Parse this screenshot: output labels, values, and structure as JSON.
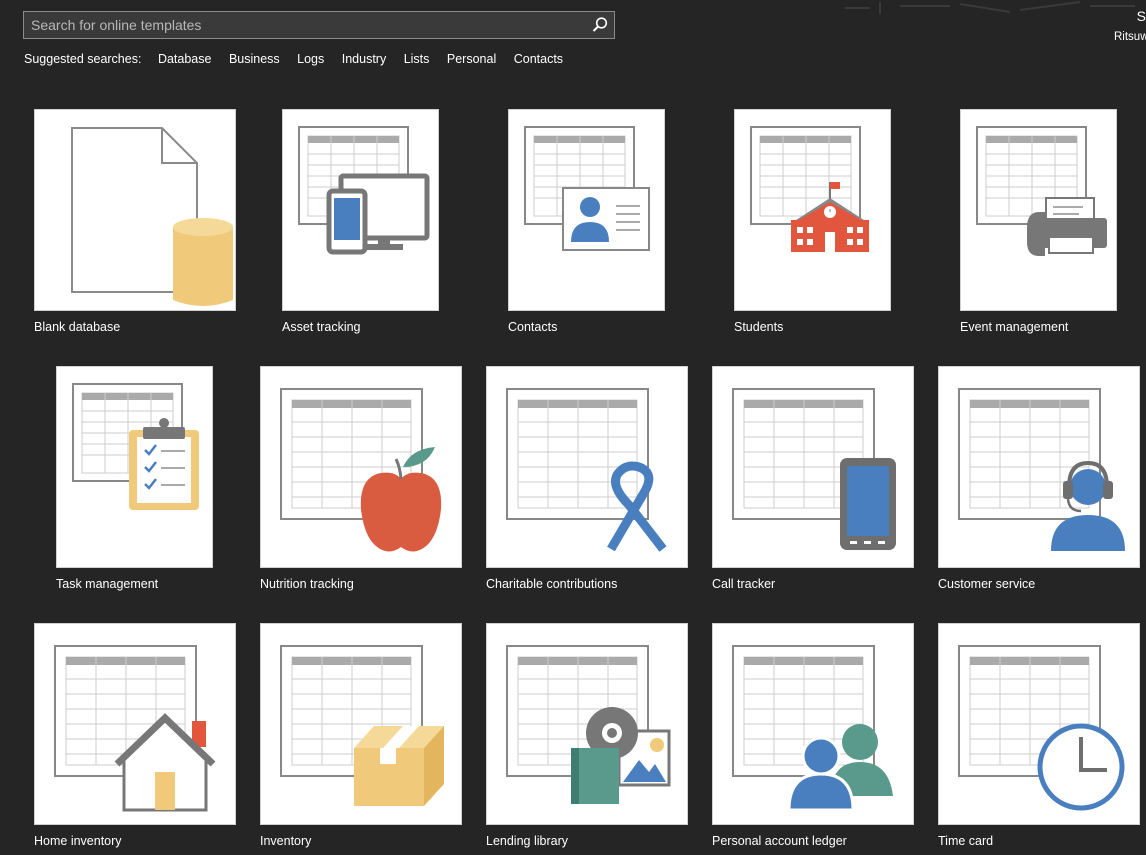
{
  "search": {
    "placeholder": "Search for online templates",
    "value": "",
    "button_icon": "search-icon"
  },
  "suggested": {
    "label": "Suggested searches:",
    "items": [
      "Database",
      "Business",
      "Logs",
      "Industry",
      "Lists",
      "Personal",
      "Contacts"
    ]
  },
  "account": {
    "initial": "S",
    "name": "Ritsuw"
  },
  "colors": {
    "background": "#252525",
    "tile": "#ffffff",
    "blue": "#4a7fbf",
    "red": "#e3563e",
    "yellow": "#f0c97a",
    "green": "#5a9a8c",
    "gray": "#777777"
  },
  "templates": [
    {
      "label": "Blank database",
      "icon": "blank-database-icon"
    },
    {
      "label": "Asset tracking",
      "icon": "asset-tracking-icon"
    },
    {
      "label": "Contacts",
      "icon": "contacts-icon"
    },
    {
      "label": "Students",
      "icon": "students-icon"
    },
    {
      "label": "Event management",
      "icon": "event-management-icon"
    },
    {
      "label": "Task management",
      "icon": "task-management-icon"
    },
    {
      "label": "Nutrition tracking",
      "icon": "nutrition-tracking-icon"
    },
    {
      "label": "Charitable contributions",
      "icon": "charitable-contributions-icon"
    },
    {
      "label": "Call tracker",
      "icon": "call-tracker-icon"
    },
    {
      "label": "Customer service",
      "icon": "customer-service-icon"
    },
    {
      "label": "Home inventory",
      "icon": "home-inventory-icon"
    },
    {
      "label": "Inventory",
      "icon": "inventory-icon"
    },
    {
      "label": "Lending library",
      "icon": "lending-library-icon"
    },
    {
      "label": "Personal account ledger",
      "icon": "personal-account-ledger-icon"
    },
    {
      "label": "Time card",
      "icon": "time-card-icon"
    }
  ]
}
